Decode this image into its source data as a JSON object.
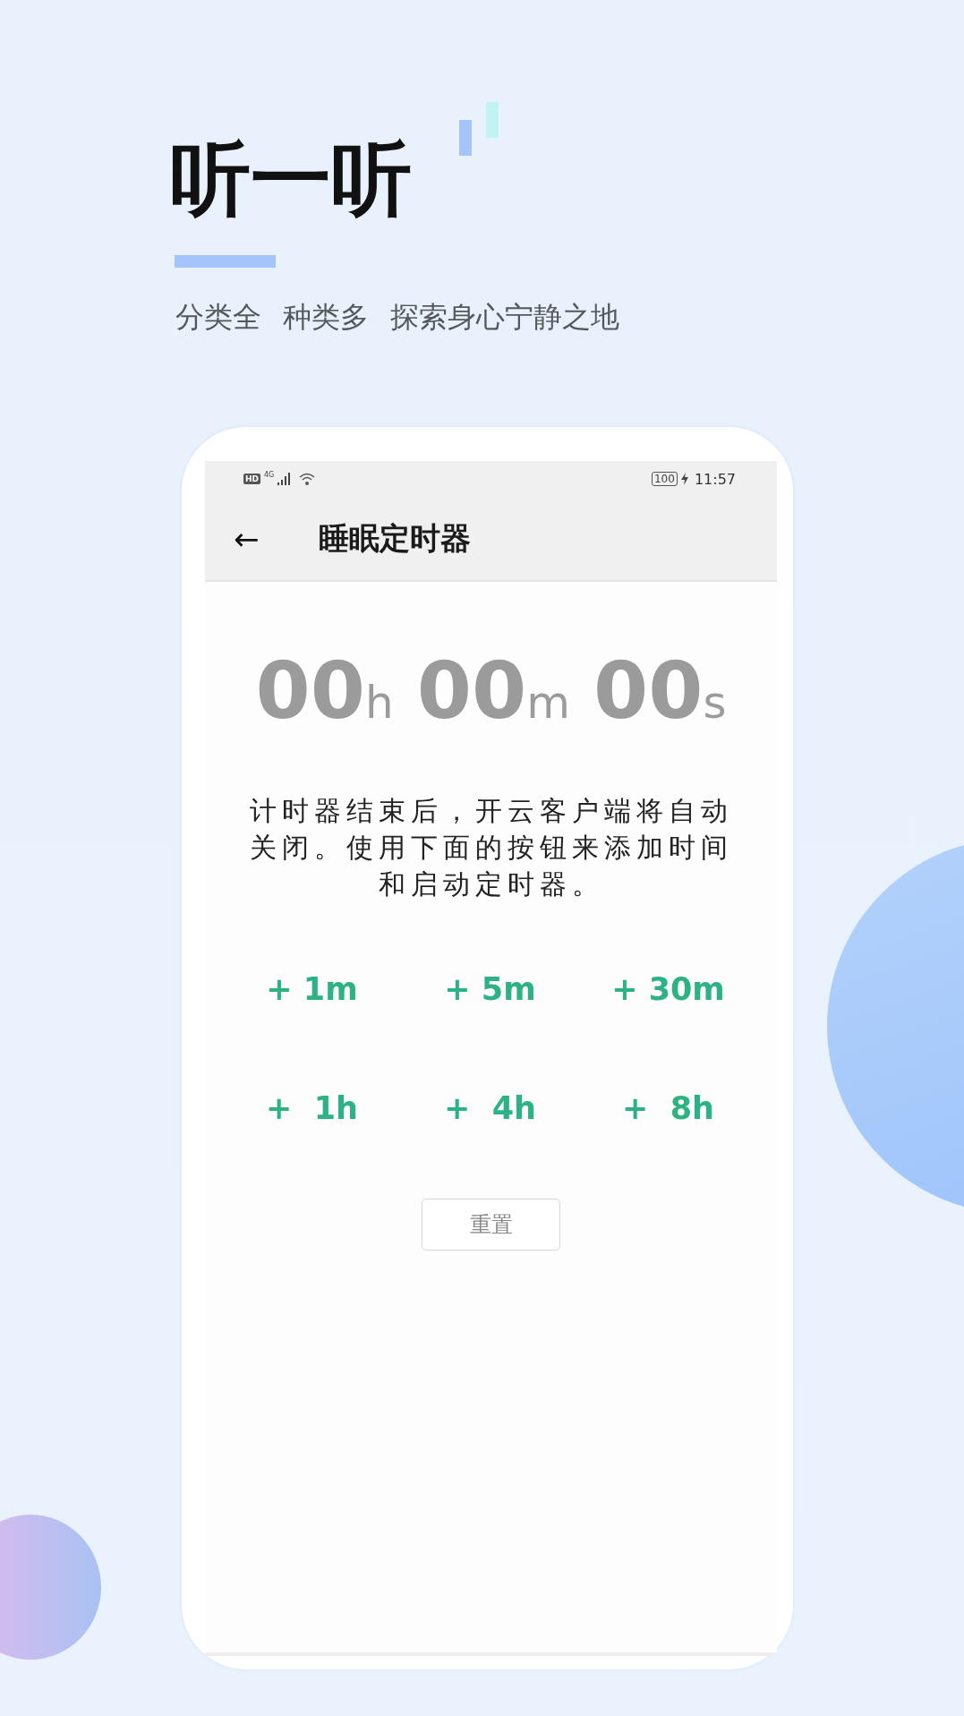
{
  "header": {
    "title": "听一听",
    "tagline": [
      "分类全",
      "种类多",
      "探索身心宁静之地"
    ]
  },
  "phone": {
    "status_bar": {
      "hd_badge": "HD",
      "network": "4G",
      "battery": "100",
      "time": "11:57"
    },
    "app_bar": {
      "back": "←",
      "title": "睡眠定时器"
    },
    "timer": [
      {
        "value": "00",
        "unit": "h"
      },
      {
        "value": "00",
        "unit": "m"
      },
      {
        "value": "00",
        "unit": "s"
      }
    ],
    "description": "计时器结束后，开云客户端将自动关闭。使用下面的按钮来添加时间和启动定时器。",
    "add_buttons": [
      "+ 1m",
      "+ 5m",
      "+ 30m",
      "+  1h",
      "+  4h",
      "+  8h"
    ],
    "reset_button": "重置"
  }
}
